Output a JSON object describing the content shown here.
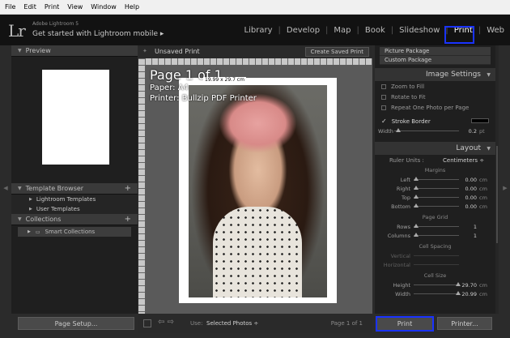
{
  "menu": [
    "File",
    "Edit",
    "Print",
    "View",
    "Window",
    "Help"
  ],
  "identity": {
    "logo": "Lr",
    "product": "Adobe Lightroom 5",
    "subtitle": "Get started with Lightroom mobile ▸"
  },
  "modules": [
    "Library",
    "Develop",
    "Map",
    "Book",
    "Slideshow",
    "Print",
    "Web"
  ],
  "active_module": "Print",
  "left_panel": {
    "preview_label": "Preview",
    "template_browser_label": "Template Browser",
    "templates": [
      "Lightroom Templates",
      "User Templates"
    ],
    "collections_label": "Collections",
    "collections": [
      "Smart Collections"
    ],
    "page_setup": "Page Setup..."
  },
  "center": {
    "title": "Unsaved Print",
    "create_saved": "Create Saved Print",
    "page_info": "Page 1 of 1",
    "paper": "Paper:  A4",
    "printer": "Printer:  Bullzip PDF Printer",
    "dims": "19.99 x 29.7 cm",
    "use_label": "Use:",
    "use_value": "Selected Photos ÷",
    "page_count": "Page 1 of 1"
  },
  "right_panel": {
    "list_items": [
      "Picture Package",
      "Custom Package"
    ],
    "image_settings_label": "Image Settings",
    "image_checks": [
      "Zoom to Fill",
      "Rotate to Fit",
      "Repeat One Photo per Page"
    ],
    "stroke_border": "Stroke Border",
    "stroke_width_label": "Width",
    "stroke_width_value": "0.2",
    "stroke_width_unit": "pt",
    "layout_label": "Layout",
    "ruler_units_label": "Ruler Units :",
    "ruler_units_value": "Centimeters ÷",
    "margins_label": "Margins",
    "margins": [
      {
        "label": "Left",
        "value": "0.00",
        "unit": "cm"
      },
      {
        "label": "Right",
        "value": "0.00",
        "unit": "cm"
      },
      {
        "label": "Top",
        "value": "0.00",
        "unit": "cm"
      },
      {
        "label": "Bottom",
        "value": "0.00",
        "unit": "cm"
      }
    ],
    "page_grid_label": "Page Grid",
    "page_grid": [
      {
        "label": "Rows",
        "value": "1",
        "unit": ""
      },
      {
        "label": "Columns",
        "value": "1",
        "unit": ""
      }
    ],
    "cell_spacing_label": "Cell Spacing",
    "cell_spacing": [
      {
        "label": "Vertical",
        "value": "",
        "unit": ""
      },
      {
        "label": "Horizontal",
        "value": "",
        "unit": ""
      }
    ],
    "cell_size_label": "Cell Size",
    "cell_size": [
      {
        "label": "Height",
        "value": "29.70",
        "unit": "cm"
      },
      {
        "label": "Width",
        "value": "20.99",
        "unit": "cm"
      }
    ],
    "print_button": "Print",
    "printer_button": "Printer..."
  }
}
